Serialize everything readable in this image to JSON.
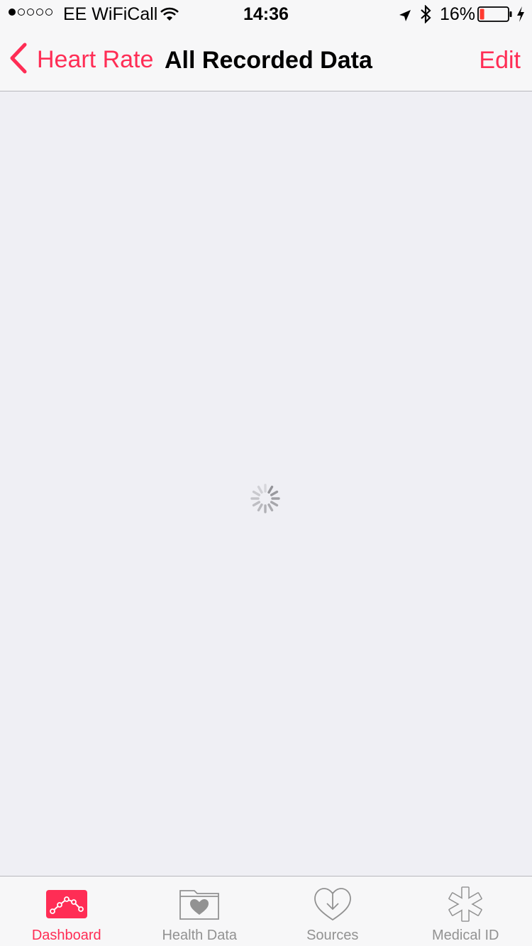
{
  "status_bar": {
    "signal_dots": [
      true,
      false,
      false,
      false,
      false
    ],
    "carrier": "EE WiFiCall",
    "time": "14:36",
    "battery_percent": "16%",
    "battery_level": 0.16,
    "icons": [
      "wifi-icon",
      "location-arrow-icon",
      "bluetooth-icon",
      "battery-icon",
      "charging-bolt-icon"
    ]
  },
  "nav": {
    "back_label": "Heart Rate",
    "title": "All Recorded Data",
    "edit_label": "Edit"
  },
  "content": {
    "state": "loading"
  },
  "tabs": [
    {
      "label": "Dashboard",
      "icon": "dashboard-chart-icon",
      "active": true
    },
    {
      "label": "Health Data",
      "icon": "health-data-folder-heart-icon",
      "active": false
    },
    {
      "label": "Sources",
      "icon": "sources-heart-download-icon",
      "active": false
    },
    {
      "label": "Medical ID",
      "icon": "medical-id-asterisk-icon",
      "active": false
    }
  ],
  "colors": {
    "accent": "#ff2d55",
    "inactive": "#929292",
    "background": "#efeff4",
    "bar": "#f7f7f8",
    "battery_low": "#ff3b30"
  }
}
